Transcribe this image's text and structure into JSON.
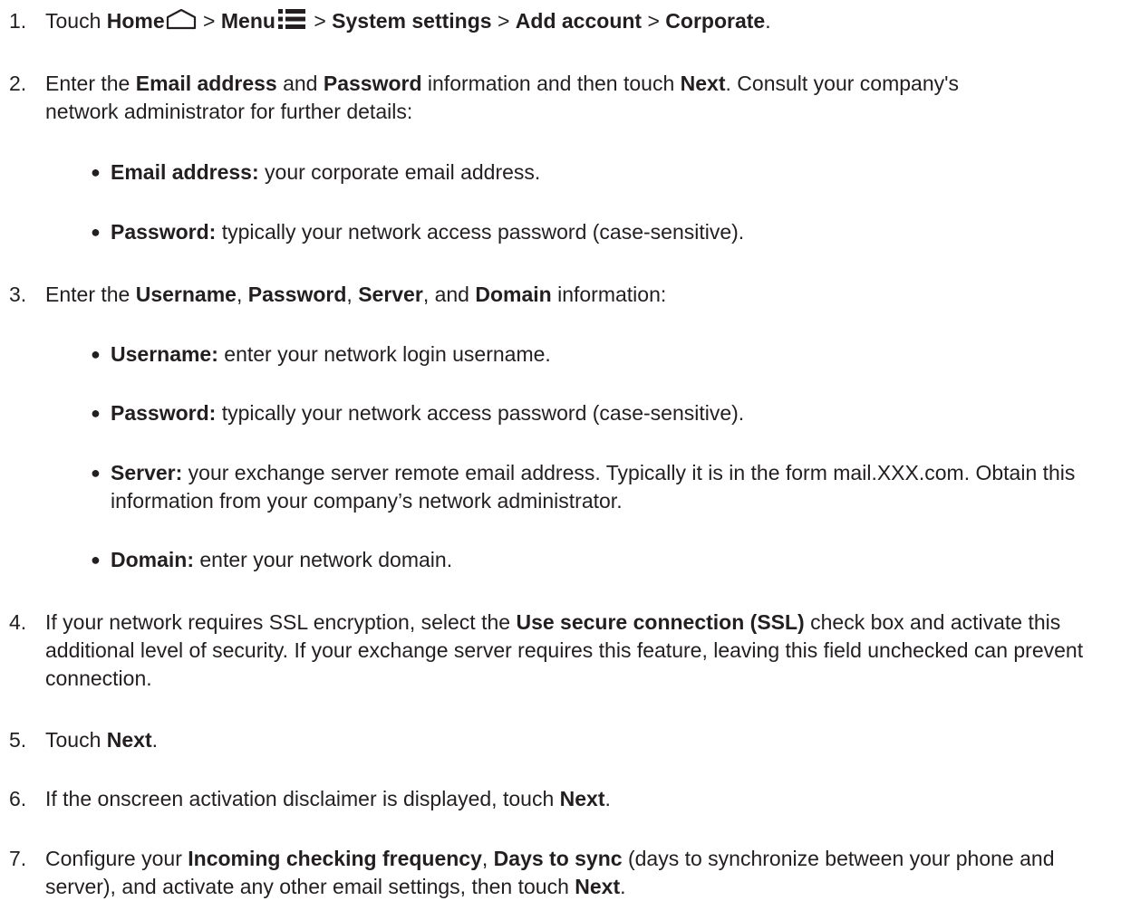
{
  "steps": [
    {
      "num": "1.",
      "parts": [
        {
          "t": "Touch "
        },
        {
          "t": "Home",
          "b": true
        },
        {
          "icon": "home-icon"
        },
        {
          "t": " > "
        },
        {
          "t": "Menu",
          "b": true
        },
        {
          "icon": "menu-icon"
        },
        {
          "t": " > "
        },
        {
          "t": "System settings",
          "b": true
        },
        {
          "t": " > "
        },
        {
          "t": "Add account",
          "b": true
        },
        {
          "t": " > "
        },
        {
          "t": "Corporate",
          "b": true
        },
        {
          "t": "."
        }
      ]
    },
    {
      "num": "2.",
      "parts": [
        {
          "t": "Enter the "
        },
        {
          "t": "Email address",
          "b": true
        },
        {
          "t": " and "
        },
        {
          "t": "Password",
          "b": true
        },
        {
          "t": " information and then touch "
        },
        {
          "t": "Next",
          "b": true
        },
        {
          "br": true
        },
        {
          "t": ". Consult your company's network administrator for further details:"
        }
      ]
    },
    {
      "num": "3.",
      "parts": [
        {
          "t": "Enter the "
        },
        {
          "t": "Username",
          "b": true
        },
        {
          "t": ", "
        },
        {
          "t": "Password",
          "b": true
        },
        {
          "t": ", "
        },
        {
          "t": "Server",
          "b": true
        },
        {
          "t": ", and "
        },
        {
          "t": "Domain",
          "b": true
        },
        {
          "t": " information:"
        }
      ]
    },
    {
      "num": "4.",
      "parts": [
        {
          "t": "If your network requires SSL encryption, select the "
        },
        {
          "t": "Use secure connection (SSL)",
          "b": true
        },
        {
          "t": " check box and activate this additional level of security. If your exchange server requires this feature, leaving this field unchecked can prevent connection."
        }
      ]
    },
    {
      "num": "5.",
      "parts": [
        {
          "t": "Touch "
        },
        {
          "t": "Next",
          "b": true
        },
        {
          "t": "."
        }
      ]
    },
    {
      "num": "6.",
      "parts": [
        {
          "t": "If the onscreen activation disclaimer is displayed, touch "
        },
        {
          "t": "Next",
          "b": true
        },
        {
          "t": "."
        }
      ]
    },
    {
      "num": "7.",
      "parts": [
        {
          "t": "Configure your "
        },
        {
          "t": "Incoming checking frequency",
          "b": true
        },
        {
          "t": ", "
        },
        {
          "t": "Days to sync",
          "b": true
        },
        {
          "t": " (days to synchronize between your phone and server), and activate any other email settings, then touch "
        },
        {
          "t": "Next",
          "b": true
        },
        {
          "t": "."
        }
      ]
    }
  ],
  "bullets": [
    {
      "parts": [
        {
          "t": "Email address:",
          "b": true
        },
        {
          "t": " your corporate email address."
        }
      ]
    },
    {
      "parts": [
        {
          "t": "Password:",
          "b": true
        },
        {
          "t": " typically your network access password (case-sensitive)."
        }
      ]
    },
    {
      "parts": [
        {
          "t": "Username:",
          "b": true
        },
        {
          "t": " enter your network login username."
        }
      ]
    },
    {
      "parts": [
        {
          "t": "Password:",
          "b": true
        },
        {
          "t": " typically your network access password (case-sensitive)."
        }
      ]
    },
    {
      "parts": [
        {
          "t": "Server:",
          "b": true
        },
        {
          "t": " your exchange server remote email address. Typically it is in the form mail.XXX.com. Obtain this information from your company’s network administrator."
        }
      ]
    },
    {
      "parts": [
        {
          "t": "Domain:",
          "b": true
        },
        {
          "t": " enter your network domain."
        }
      ]
    }
  ]
}
